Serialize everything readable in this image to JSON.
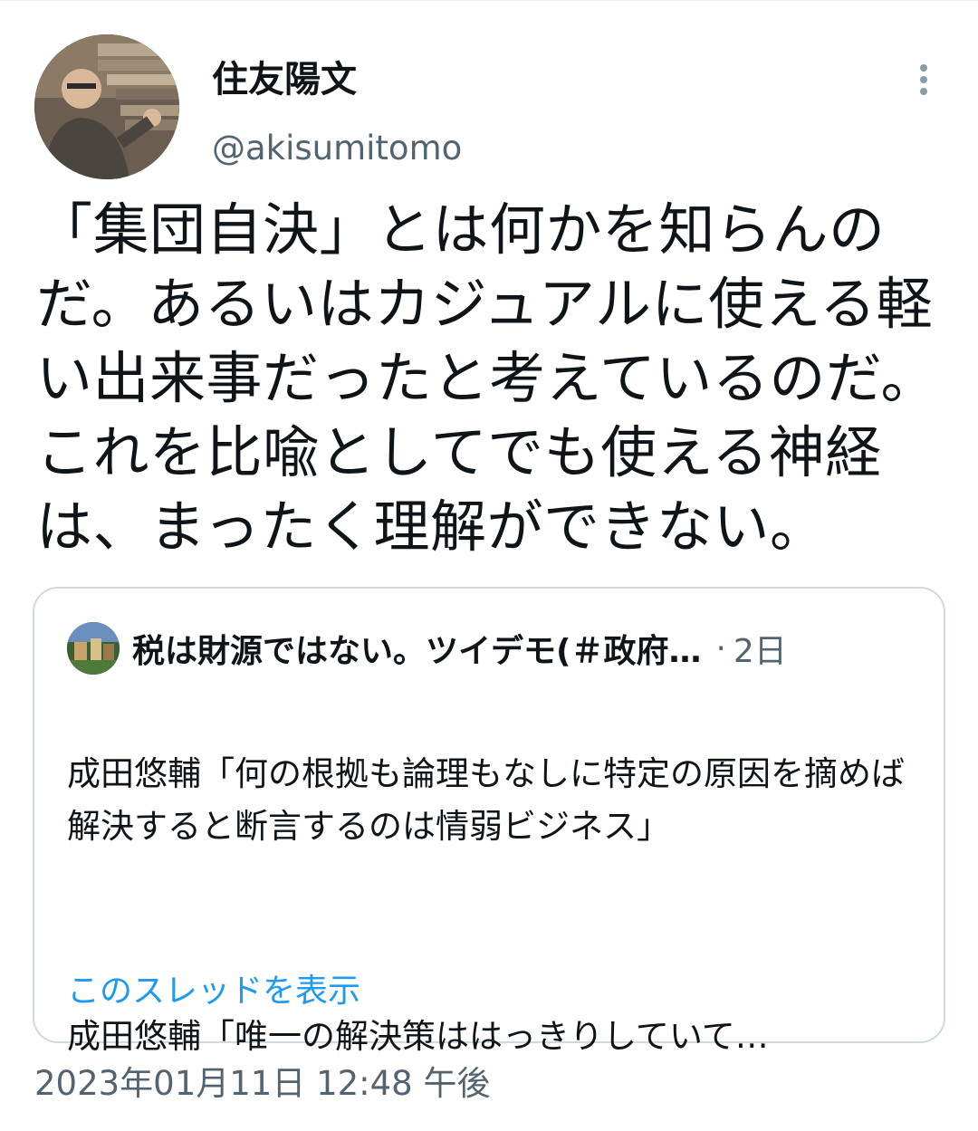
{
  "author": {
    "display_name": "住友陽文",
    "handle": "@akisumitomo",
    "avatar_icon": "user-avatar"
  },
  "menu_icon": "more-vertical-icon",
  "tweet": {
    "text": "「集団自決」とは何かを知らんのだ。あるいはカジュアルに使える軽い出来事だったと考えているのだ。これを比喩としてでも使える神経は、まったく理解ができない。",
    "timestamp": "2023年01月11日 12:48 午後"
  },
  "quoted": {
    "display_name": "税は財源ではない。ツイデモ(＃政府…",
    "separator": "·",
    "time": "2日",
    "body_1": "成田悠輔「何の根拠も論理もなしに特定の原因を摘めば解決すると断言するのは情弱ビジネス」",
    "body_2": "成田悠輔「唯一の解決策ははっきりしていて…",
    "show_thread": "このスレッドを表示"
  },
  "colors": {
    "text_primary": "#0f1419",
    "text_secondary": "#536471",
    "link": "#1d9bf0",
    "border": "#cfd9de"
  }
}
